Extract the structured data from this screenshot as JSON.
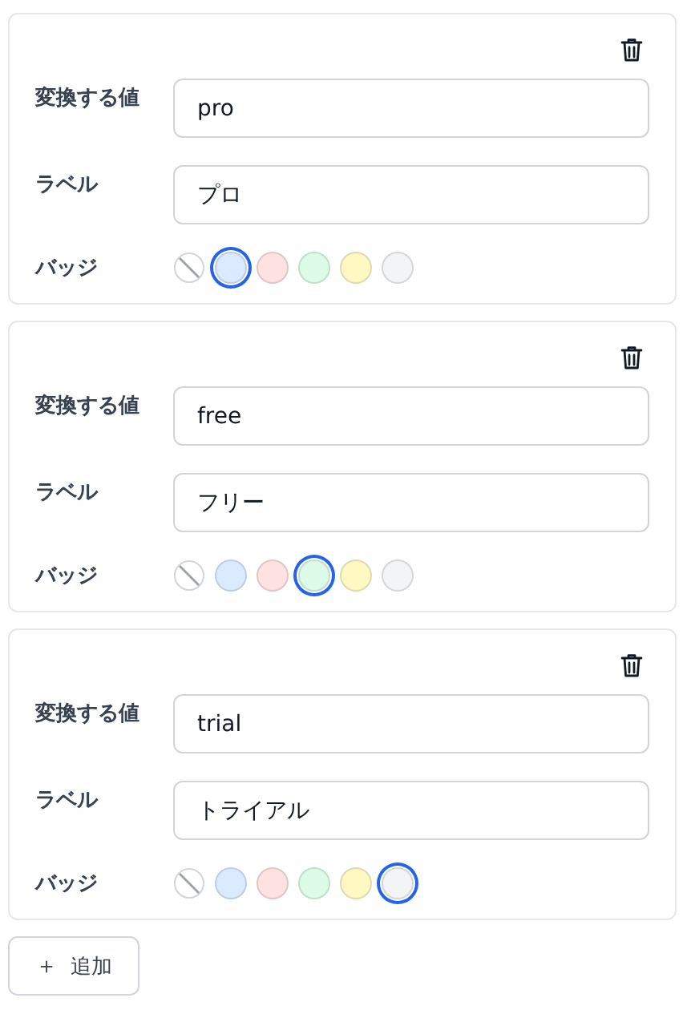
{
  "mappings": [
    {
      "value_label": "変換する値",
      "value": "pro",
      "label_label": "ラベル",
      "label": "プロ",
      "badge_label": "バッジ",
      "badges": [
        {
          "kind": "none",
          "selected": false
        },
        {
          "kind": "swatch",
          "color": "#dbeafe",
          "selected": true
        },
        {
          "kind": "swatch",
          "color": "#fee2e2",
          "selected": false
        },
        {
          "kind": "swatch",
          "color": "#dcfce7",
          "selected": false
        },
        {
          "kind": "swatch",
          "color": "#fef9c3",
          "selected": false
        },
        {
          "kind": "swatch",
          "color": "#f3f4f6",
          "selected": false
        }
      ]
    },
    {
      "value_label": "変換する値",
      "value": "free",
      "label_label": "ラベル",
      "label": "フリー",
      "badge_label": "バッジ",
      "badges": [
        {
          "kind": "none",
          "selected": false
        },
        {
          "kind": "swatch",
          "color": "#dbeafe",
          "selected": false
        },
        {
          "kind": "swatch",
          "color": "#fee2e2",
          "selected": false
        },
        {
          "kind": "swatch",
          "color": "#dcfce7",
          "selected": true
        },
        {
          "kind": "swatch",
          "color": "#fef9c3",
          "selected": false
        },
        {
          "kind": "swatch",
          "color": "#f3f4f6",
          "selected": false
        }
      ]
    },
    {
      "value_label": "変換する値",
      "value": "trial",
      "label_label": "ラベル",
      "label": "トライアル",
      "badge_label": "バッジ",
      "badges": [
        {
          "kind": "none",
          "selected": false
        },
        {
          "kind": "swatch",
          "color": "#dbeafe",
          "selected": false
        },
        {
          "kind": "swatch",
          "color": "#fee2e2",
          "selected": false
        },
        {
          "kind": "swatch",
          "color": "#dcfce7",
          "selected": false
        },
        {
          "kind": "swatch",
          "color": "#fef9c3",
          "selected": false
        },
        {
          "kind": "swatch",
          "color": "#f3f4f6",
          "selected": true
        }
      ]
    }
  ],
  "add_button": {
    "icon": "＋",
    "label": "追加"
  }
}
